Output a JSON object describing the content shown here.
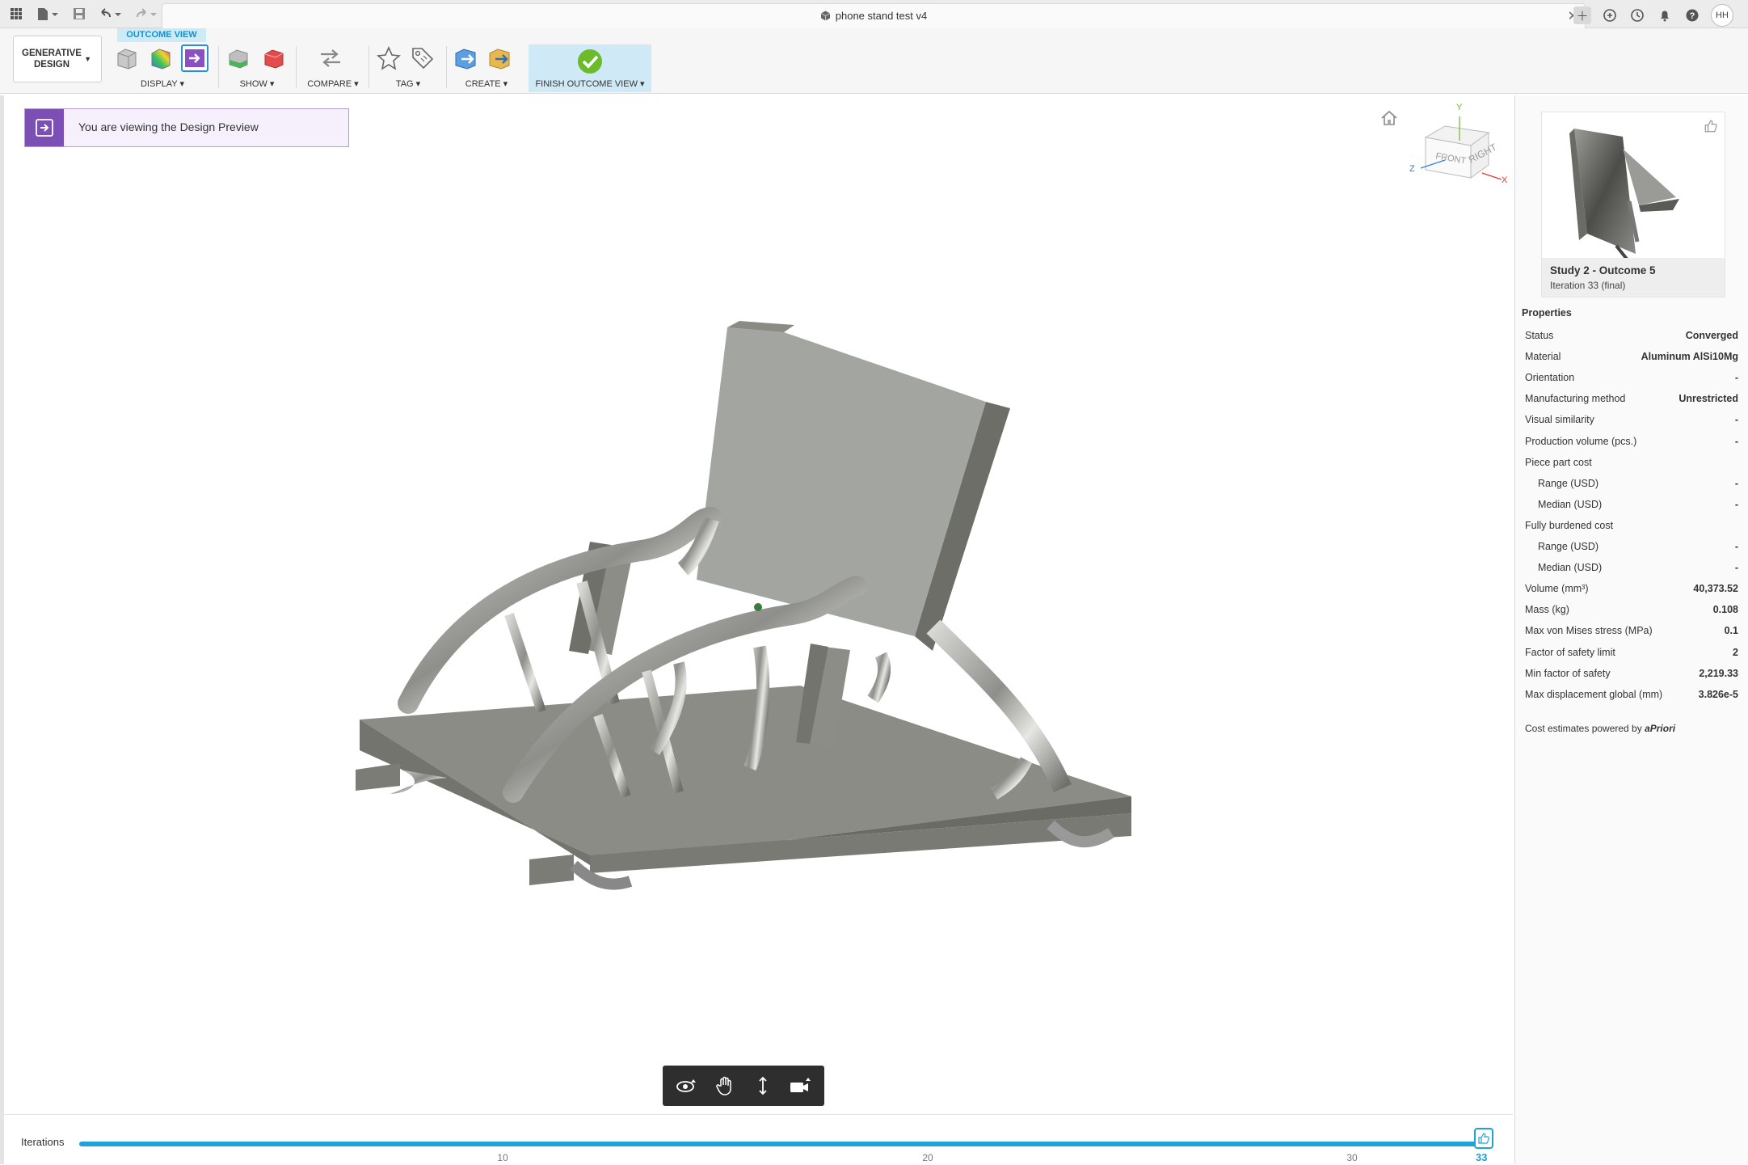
{
  "titlebar": {
    "document_title": "phone stand test v4",
    "user_initials": "HH"
  },
  "ribbon": {
    "workspace_line1": "GENERATIVE",
    "workspace_line2": "DESIGN",
    "context_tab": "OUTCOME VIEW",
    "groups": {
      "display": "DISPLAY ▾",
      "show": "SHOW ▾",
      "compare": "COMPARE ▾",
      "tag": "TAG ▾",
      "create": "CREATE ▾",
      "finish": "FINISH OUTCOME VIEW ▾"
    }
  },
  "banner": {
    "text": "You are viewing the Design Preview"
  },
  "viewcube": {
    "front": "FRONT",
    "right": "RIGHT",
    "axis_y": "Y",
    "axis_z": "Z",
    "axis_x": "X"
  },
  "iterations": {
    "label": "Iterations",
    "ticks": [
      "10",
      "20",
      "30"
    ],
    "current": "33",
    "max": 33,
    "position": 33
  },
  "panel": {
    "outcome_title": "Study 2 - Outcome 5",
    "outcome_subtitle": "Iteration 33 (final)",
    "properties_title": "Properties",
    "properties": [
      {
        "key": "Status",
        "value": "Converged",
        "indent": false
      },
      {
        "key": "Material",
        "value": "Aluminum AlSi10Mg",
        "indent": false
      },
      {
        "key": "Orientation",
        "value": "-",
        "indent": false
      },
      {
        "key": "Manufacturing method",
        "value": "Unrestricted",
        "indent": false
      },
      {
        "key": "Visual similarity",
        "value": "-",
        "indent": false
      },
      {
        "key": "Production volume (pcs.)",
        "value": "-",
        "indent": false
      },
      {
        "key": "Piece part cost",
        "value": "",
        "indent": false
      },
      {
        "key": "Range (USD)",
        "value": "-",
        "indent": true
      },
      {
        "key": "Median (USD)",
        "value": "-",
        "indent": true
      },
      {
        "key": "Fully burdened cost",
        "value": "",
        "indent": false
      },
      {
        "key": "Range (USD)",
        "value": "-",
        "indent": true
      },
      {
        "key": "Median (USD)",
        "value": "-",
        "indent": true
      },
      {
        "key": "Volume (mm³)",
        "value": "40,373.52",
        "indent": false
      },
      {
        "key": "Mass (kg)",
        "value": "0.108",
        "indent": false
      },
      {
        "key": "Max von Mises stress (MPa)",
        "value": "0.1",
        "indent": false
      },
      {
        "key": "Factor of safety limit",
        "value": "2",
        "indent": false
      },
      {
        "key": "Min factor of safety",
        "value": "2,219.33",
        "indent": false
      },
      {
        "key": "Max displacement global (mm)",
        "value": "3.826e-5",
        "indent": false
      }
    ],
    "cost_note_prefix": "Cost estimates powered by",
    "cost_note_brand": "aPriori"
  },
  "colors": {
    "accent": "#0696d7",
    "iteration_bar": "#1ea3d9",
    "banner_purple": "#7b4fb3",
    "finish_check": "#6cbb2a"
  }
}
